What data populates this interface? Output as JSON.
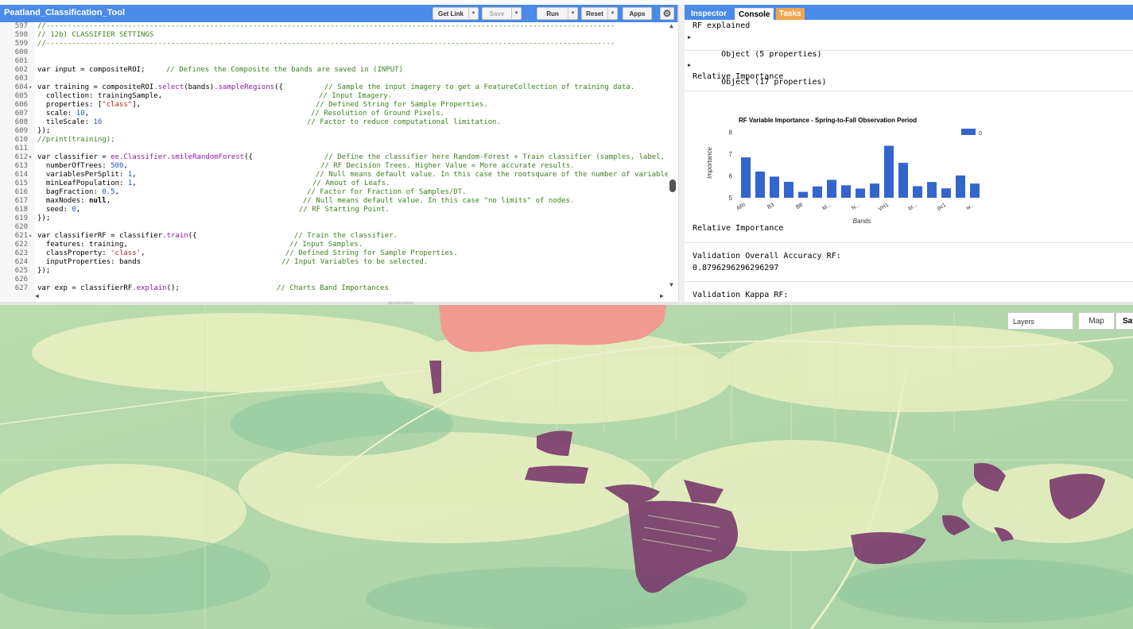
{
  "editor": {
    "title": "Peatland_Classification_Tool",
    "buttons": {
      "get_link": "Get Link",
      "save": "Save",
      "run": "Run",
      "reset": "Reset",
      "apps": "Apps"
    },
    "code_lines": [
      {
        "n": "597",
        "code": "",
        "comment": "//------------------------------------------------------------------------------------------------------------------------------------"
      },
      {
        "n": "598",
        "code": "",
        "comment": "// 12b) CLASSIFIER SETTINGS"
      },
      {
        "n": "599",
        "code": "",
        "comment": "//------------------------------------------------------------------------------------------------------------------------------------"
      },
      {
        "n": "600",
        "code": "",
        "comment": ""
      },
      {
        "n": "601",
        "code": "",
        "comment": ""
      },
      {
        "n": "602",
        "code": "var input = compositeROI;",
        "comment": "// Defines the Composite the bands are saved in (INPUT)"
      },
      {
        "n": "603",
        "code": "",
        "comment": ""
      },
      {
        "n": "604",
        "code": "var training = compositeROI.select(bands).sampleRegions({",
        "comment": "// Sample the input imagery to get a FeatureCollection of training data."
      },
      {
        "n": "605",
        "code": "  collection: trainingSample,",
        "comment": "// Input Imagery."
      },
      {
        "n": "606",
        "code": "  properties: [\"class\"],",
        "comment": "// Defined String for Sample Properties."
      },
      {
        "n": "607",
        "code": "  scale: 10,",
        "comment": "// Resolution of Ground Pixels."
      },
      {
        "n": "608",
        "code": "  tileScale: 16",
        "comment": "// Factor to reduce computational limitation."
      },
      {
        "n": "609",
        "code": "});",
        "comment": ""
      },
      {
        "n": "610",
        "code": "",
        "comment": "//print(training);"
      },
      {
        "n": "611",
        "code": "",
        "comment": ""
      },
      {
        "n": "612",
        "code": "var classifier = ee.Classifier.smileRandomForest({",
        "comment": "// Define the classifier here Random-Forest + Train classifier (samples, label, b"
      },
      {
        "n": "613",
        "code": "  numberOfTrees: 500,",
        "comment": "// RF Decision Trees. Higher Value = More accurate results."
      },
      {
        "n": "614",
        "code": "  variablesPerSplit: 1,",
        "comment": "// Null means default value. In this case the rootsquare of the number of variables"
      },
      {
        "n": "615",
        "code": "  minLeafPopulation: 1,",
        "comment": "// Amout of Leafs."
      },
      {
        "n": "616",
        "code": "  bagFraction: 0.5,",
        "comment": "// Factor for Fraction of Samples/DT."
      },
      {
        "n": "617",
        "code": "  maxNodes: null,",
        "comment": "// Null means default value. In this case \"no limits\" of nodes."
      },
      {
        "n": "618",
        "code": "  seed: 0,",
        "comment": "// RF Starting Point."
      },
      {
        "n": "619",
        "code": "});",
        "comment": ""
      },
      {
        "n": "620",
        "code": "",
        "comment": ""
      },
      {
        "n": "621",
        "code": "var classifierRF = classifier.train({",
        "comment": "// Train the classifier."
      },
      {
        "n": "622",
        "code": "  features: training,",
        "comment": "// Input Samples."
      },
      {
        "n": "623",
        "code": "  classProperty: 'class',",
        "comment": "// Defined String for Sample Properties."
      },
      {
        "n": "624",
        "code": "  inputProperties: bands",
        "comment": "// Input Variables to be selected."
      },
      {
        "n": "625",
        "code": "});",
        "comment": ""
      },
      {
        "n": "626",
        "code": "",
        "comment": ""
      },
      {
        "n": "627",
        "code": "var exp = classifierRF.explain();",
        "comment": "// Charts Band Importances"
      }
    ]
  },
  "right_panel": {
    "tabs": {
      "inspector": "Inspector",
      "console": "Console",
      "tasks": "Tasks"
    },
    "console": {
      "rf_explained": "RF explained",
      "object5": "Object (5 properties)",
      "object17": "Object (17 properties)",
      "rel_imp_1": "Relative Importance",
      "rel_imp_2": "Relative Importance",
      "val_oa_label": "Validation Overall Accuracy RF:",
      "val_oa_value": "0.8796296296296297",
      "val_kappa_label": "Validation Kappa RF:"
    }
  },
  "chart_data": {
    "type": "bar",
    "title": "RF Variable Importance - Spring-to-Fall Observation Period",
    "xlabel": "Bands",
    "ylabel": "Importance",
    "ylim": [
      5,
      8.2
    ],
    "yticks": [
      5,
      6,
      7,
      8
    ],
    "legend": "top-right",
    "series": [
      {
        "name": "0",
        "color": "#3366cc",
        "values": [
          6.85,
          6.2,
          5.97,
          5.73,
          5.27,
          5.52,
          5.82,
          5.57,
          5.42,
          5.65,
          7.38,
          6.6,
          5.53,
          5.72,
          5.43,
          6.02,
          5.65
        ]
      }
    ],
    "tick_labels": [
      "ARI",
      "",
      "B3",
      "",
      "B8",
      "",
      "M...",
      "",
      "N...",
      "",
      "VH1",
      "",
      "br...",
      "",
      "pc1",
      "",
      "w..."
    ]
  },
  "map": {
    "layers_label": "Layers",
    "map_button": "Map",
    "satellite_button": "Sat"
  }
}
